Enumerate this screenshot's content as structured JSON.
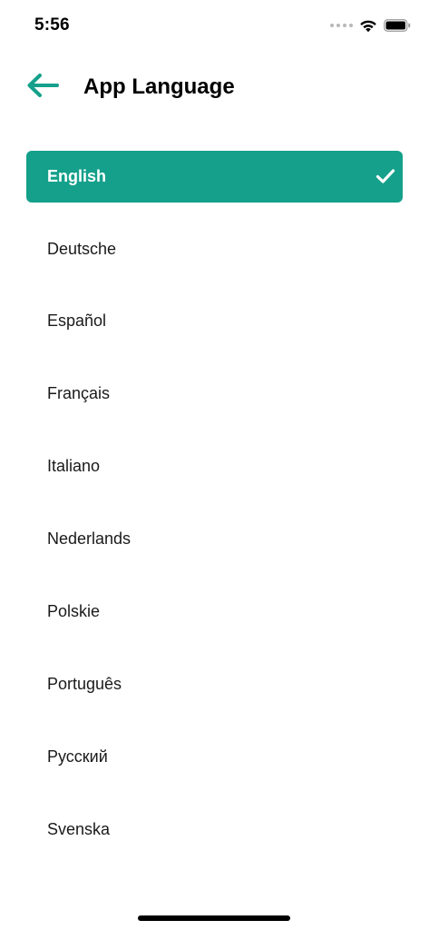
{
  "status_bar": {
    "time": "5:56"
  },
  "header": {
    "back_icon": "arrow-left-icon",
    "title": "App Language"
  },
  "colors": {
    "accent": "#14a08b"
  },
  "languages": [
    {
      "label": "English",
      "selected": true
    },
    {
      "label": "Deutsche",
      "selected": false
    },
    {
      "label": "Español",
      "selected": false
    },
    {
      "label": "Français",
      "selected": false
    },
    {
      "label": "Italiano",
      "selected": false
    },
    {
      "label": "Nederlands",
      "selected": false
    },
    {
      "label": "Polskie",
      "selected": false
    },
    {
      "label": "Português",
      "selected": false
    },
    {
      "label": "Русский",
      "selected": false
    },
    {
      "label": "Svenska",
      "selected": false
    }
  ]
}
